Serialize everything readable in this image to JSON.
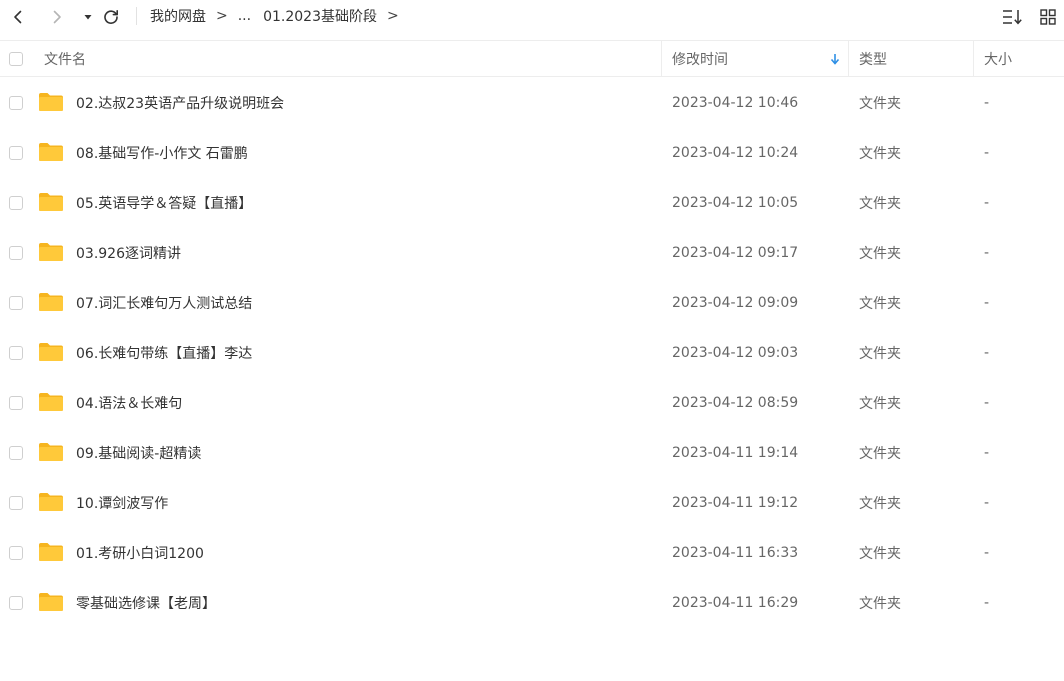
{
  "toolbar": {
    "breadcrumb": {
      "root": "我的网盘",
      "separator": ">",
      "ellipsis": "...",
      "current": "01.2023基础阶段"
    }
  },
  "table": {
    "headers": {
      "name": "文件名",
      "modified": "修改时间",
      "type": "类型",
      "size": "大小"
    },
    "sort_column": "modified",
    "rows": [
      {
        "name": "02.达叔23英语产品升级说明班会",
        "modified": "2023-04-12 10:46",
        "type": "文件夹",
        "size": "-"
      },
      {
        "name": "08.基础写作-小作文 石雷鹏",
        "modified": "2023-04-12 10:24",
        "type": "文件夹",
        "size": "-"
      },
      {
        "name": "05.英语导学＆答疑【直播】",
        "modified": "2023-04-12 10:05",
        "type": "文件夹",
        "size": "-"
      },
      {
        "name": "03.926逐词精讲",
        "modified": "2023-04-12 09:17",
        "type": "文件夹",
        "size": "-"
      },
      {
        "name": "07.词汇长难句万人测试总结",
        "modified": "2023-04-12 09:09",
        "type": "文件夹",
        "size": "-"
      },
      {
        "name": "06.长难句带练【直播】李达",
        "modified": "2023-04-12 09:03",
        "type": "文件夹",
        "size": "-"
      },
      {
        "name": "04.语法＆长难句",
        "modified": "2023-04-12 08:59",
        "type": "文件夹",
        "size": "-"
      },
      {
        "name": "09.基础阅读-超精读",
        "modified": "2023-04-11 19:14",
        "type": "文件夹",
        "size": "-"
      },
      {
        "name": "10.谭剑波写作",
        "modified": "2023-04-11 19:12",
        "type": "文件夹",
        "size": "-"
      },
      {
        "name": "01.考研小白词1200",
        "modified": "2023-04-11 16:33",
        "type": "文件夹",
        "size": "-"
      },
      {
        "name": "零基础选修课【老周】",
        "modified": "2023-04-11 16:29",
        "type": "文件夹",
        "size": "-"
      }
    ]
  },
  "icons": {
    "folder": "folder-icon",
    "back": "chevron-left-icon",
    "forward": "chevron-right-icon",
    "history": "caret-down-icon",
    "refresh": "refresh-icon",
    "sort": "arrow-down-icon",
    "list_view": "list-view-icon",
    "grid_view": "grid-view-icon"
  },
  "colors": {
    "folder": "#FFC93A",
    "folder_tab": "#F6B51F",
    "sort_arrow": "#2E8FE5",
    "border": "#EDEDED"
  }
}
